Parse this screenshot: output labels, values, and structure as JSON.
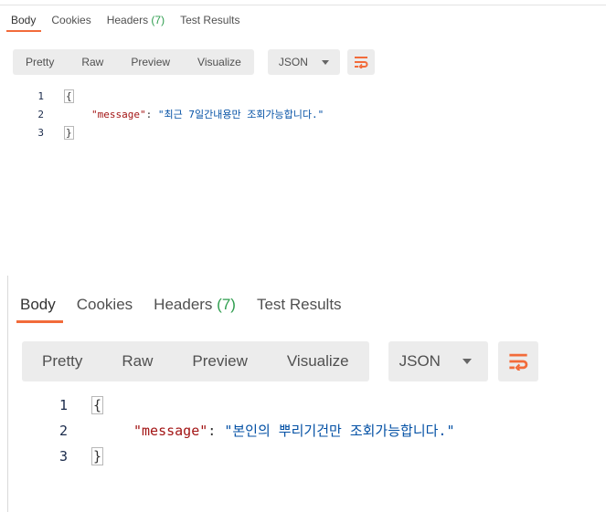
{
  "panels": [
    {
      "tabs": {
        "body": "Body",
        "cookies": "Cookies",
        "headers": "Headers",
        "headers_count": "(7)",
        "test_results": "Test Results"
      },
      "toolbar": {
        "pretty": "Pretty",
        "raw": "Raw",
        "preview": "Preview",
        "visualize": "Visualize",
        "format": "JSON"
      },
      "code": {
        "line_numbers": [
          "1",
          "2",
          "3"
        ],
        "open_brace": "{",
        "close_brace": "}",
        "key": "\"message\"",
        "colon": ": ",
        "value": "\"최근 7일간내용만 조회가능합니다.\""
      }
    },
    {
      "tabs": {
        "body": "Body",
        "cookies": "Cookies",
        "headers": "Headers",
        "headers_count": "(7)",
        "test_results": "Test Results"
      },
      "toolbar": {
        "pretty": "Pretty",
        "raw": "Raw",
        "preview": "Preview",
        "visualize": "Visualize",
        "format": "JSON"
      },
      "code": {
        "line_numbers": [
          "1",
          "2",
          "3"
        ],
        "open_brace": "{",
        "close_brace": "}",
        "key": "\"message\"",
        "colon": ": ",
        "value": "\"본인의 뿌리기건만 조회가능합니다.\""
      }
    }
  ],
  "icons": {
    "wrap": "wrap-lines-icon",
    "dropdown": "chevron-down-icon"
  },
  "colors": {
    "accent": "#f26b3a",
    "count": "#2e9d4e",
    "json_key": "#a31515",
    "json_string": "#0451a5"
  }
}
